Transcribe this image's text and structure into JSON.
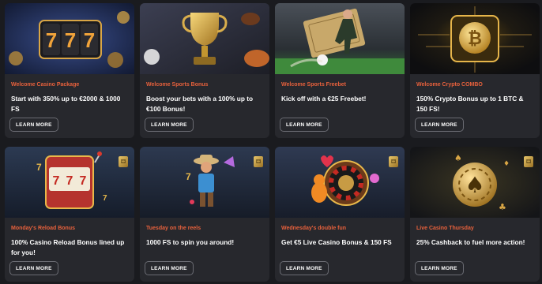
{
  "promotions": [
    {
      "category": "Welcome Casino Package",
      "title": "Start with 350% up to €2000 & 1000 FS",
      "button": "LEARN MORE",
      "image": "slot-777-reels-icon"
    },
    {
      "category": "Welcome Sports Bonus",
      "title": "Boost your bets with a 100% up to €100 Bonus!",
      "button": "LEARN MORE",
      "image": "trophy-icon"
    },
    {
      "category": "Welcome Sports Freebet",
      "title": "Kick off with a €25 Freebet!",
      "button": "LEARN MORE",
      "image": "football-player-icon"
    },
    {
      "category": "Welcome Crypto COMBO",
      "title": "150% Crypto Bonus up to 1 BTC & 150 FS!",
      "button": "LEARN MORE",
      "image": "bitcoin-chip-icon"
    },
    {
      "category": "Monday's Reload Bonus",
      "title": "100% Casino Reload Bonus lined up for you!",
      "button": "LEARN MORE",
      "image": "slot-machine-icon"
    },
    {
      "category": "Tuesday on the reels",
      "title": "1000 FS to spin you around!",
      "button": "LEARN MORE",
      "image": "cowboy-character-icon"
    },
    {
      "category": "Wednesday's double fun",
      "title": "Get €5 Live Casino Bonus & 150 FS",
      "button": "LEARN MORE",
      "image": "roulette-wheel-icon"
    },
    {
      "category": "Live Casino Thursday",
      "title": "25% Cashback to fuel more action!",
      "button": "LEARN MORE",
      "image": "spade-chip-icon"
    }
  ],
  "colors": {
    "background": "#1a1b1f",
    "card": "#27282d",
    "category": "#e8613c",
    "text": "#ffffff",
    "gold": "#e8b84a"
  }
}
